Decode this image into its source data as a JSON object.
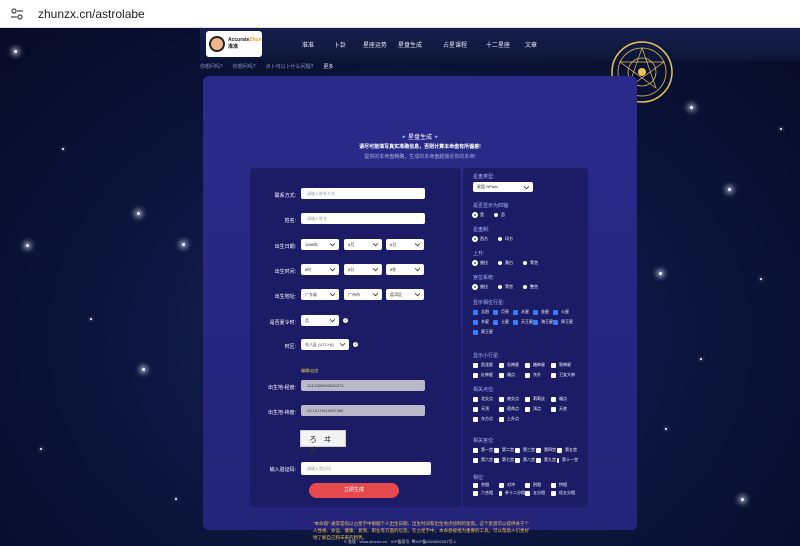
{
  "browser": {
    "url": "zhunzx.cn/astrolabe"
  },
  "nav": {
    "logo_text": "Accurate",
    "logo_text_hl": "Zhun",
    "logo_sub": "准准",
    "items": [
      "准准",
      "卜卦",
      "星座运势",
      "星盘生成",
      "占星课程",
      "十二星座",
      "文章"
    ]
  },
  "subnav": [
    "url:url",
    "你想问吗?",
    "你想问吗?",
    "点卜可以卜什么问题?",
    "更多"
  ],
  "panel": {
    "title": "星盘生成",
    "sub1": "请尽可能填写真实准确信息，否则计算本命盘有所偏差!",
    "sub2": "提供的本命盘精确，生成的本命盘越接近你的本命!"
  },
  "form": {
    "contact_label": "联系方式:",
    "contact_placeholder": "请输入联系方式",
    "name_label": "姓名:",
    "name_placeholder": "请输入姓名",
    "birthdate_label": "出生日期:",
    "year": "1988年",
    "month": "8月",
    "day": "8日",
    "birthtime_label": "出生时间:",
    "hour": "8时",
    "minute": "8分",
    "second": "8秒",
    "birthplace_label": "出生地址:",
    "province": "广东省",
    "city": "广州市",
    "district": "荔湾区",
    "dst_label": "是否夏令时:",
    "dst_value": "否",
    "tz_label": "时区:",
    "tz_value": "东八区 (UTC+8)",
    "geo_tip": "编辑/自由",
    "longitude_label": "出生地-经度:",
    "longitude_value": "113.2306922630373",
    "latitude_label": "出生地-纬度:",
    "latitude_value": "23.13179115497455",
    "captcha_text": "ろ ヰ ゑ",
    "code_label": "输入验证码:",
    "code_placeholder": "请输入验证码",
    "submit": "立即生成"
  },
  "options": {
    "type_label": "星盘类型:",
    "type_value": "星盘 NPlain",
    "asc_label": "是否显示为四轴:",
    "asc_yes": "是",
    "asc_no": "否",
    "system_label": "星盘制:",
    "system_a": "西方",
    "system_b": "印方",
    "house_label": "上升:",
    "house_a": "普拉",
    "house_b": "黄白",
    "house_c": "等宫",
    "aspect_label": "宫位系统:",
    "aspect_a": "普拉",
    "aspect_b": "等宫",
    "aspect_c": "整宫",
    "planet_label": "显示相位行星:",
    "planets": [
      {
        "name": "太阳",
        "on": true
      },
      {
        "name": "月亮",
        "on": true
      },
      {
        "name": "水星",
        "on": true
      },
      {
        "name": "金星",
        "on": true
      },
      {
        "name": "火星",
        "on": true
      },
      {
        "name": "木星",
        "on": true
      },
      {
        "name": "土星",
        "on": true
      },
      {
        "name": "天王星",
        "on": true
      },
      {
        "name": "海王星",
        "on": true
      },
      {
        "name": "冥王星",
        "on": true
      },
      {
        "name": "冥王星",
        "on": true
      }
    ],
    "aster_label": "显示小行星:",
    "asteroids": [
      "凯龙星",
      "谷神星",
      "婚神星",
      "智神星",
      "灶神星",
      "福点",
      "东升",
      "卫女大神"
    ],
    "points_label": "相关点位:",
    "points": [
      "北交点",
      "南交点",
      "莉莉丝",
      "福点",
      "天顶",
      "宿命点",
      "顶点",
      "天底",
      "东方点",
      "上升点"
    ],
    "houses_label": "相关宫位:",
    "houses": [
      "第一宫",
      "第二宫",
      "第三宫",
      "第四宫",
      "第五宫",
      "第六宫",
      "第七宫",
      "第八宫",
      "第九宫",
      "第十一宫",
      "第十二宫",
      "第十宫"
    ],
    "phase_label": "相位:",
    "phases": [
      "合相",
      "对冲",
      "刑相",
      "拱相",
      "六合相",
      "补十二分相",
      "五分相",
      "倍五分相",
      "八分相",
      "补八分相",
      "九分相",
      "半六分相",
      "相邻半",
      "十分相",
      "大三一",
      "美分相"
    ]
  },
  "footnote": "\"本命盘\" 通常是指以占星学中根据个人出生日期、出生时间和出生地点绘制的星盘。这个星盘可以提供关于个人性格、命运、健康、爱情、职业等方面的信息。在占星学中，本命盘被视为重要的工具，可以帮助人们更好地了解自己和未来的趋势。",
  "copyright": "© 准准 · www.zhunzx.cn · ICP备案号: 粤ICP备2024052267号-1"
}
